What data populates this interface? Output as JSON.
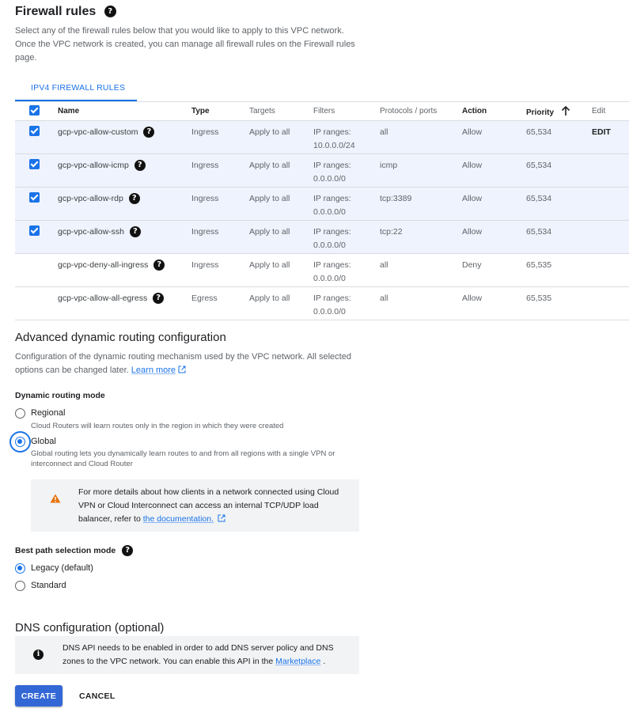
{
  "firewall": {
    "title": "Firewall rules",
    "description": "Select any of the firewall rules below that you would like to apply to this VPC network. Once the VPC network is created, you can manage all firewall rules on the Firewall rules page.",
    "tab_label": "IPV4 FIREWALL RULES",
    "columns": {
      "name": "Name",
      "type": "Type",
      "targets": "Targets",
      "filters": "Filters",
      "protocols": "Protocols / ports",
      "action": "Action",
      "priority": "Priority",
      "edit": "Edit"
    },
    "rows": [
      {
        "name": "gcp-vpc-allow-custom",
        "type": "Ingress",
        "targets": "Apply to all",
        "filter_label": "IP ranges:",
        "filter_value": "10.0.0.0/24",
        "protocols": "all",
        "action": "Allow",
        "priority": "65,534",
        "edit": "EDIT",
        "checked": true
      },
      {
        "name": "gcp-vpc-allow-icmp",
        "type": "Ingress",
        "targets": "Apply to all",
        "filter_label": "IP ranges:",
        "filter_value": "0.0.0.0/0",
        "protocols": "icmp",
        "action": "Allow",
        "priority": "65,534",
        "edit": "",
        "checked": true
      },
      {
        "name": "gcp-vpc-allow-rdp",
        "type": "Ingress",
        "targets": "Apply to all",
        "filter_label": "IP ranges:",
        "filter_value": "0.0.0.0/0",
        "protocols": "tcp:3389",
        "action": "Allow",
        "priority": "65,534",
        "edit": "",
        "checked": true
      },
      {
        "name": "gcp-vpc-allow-ssh",
        "type": "Ingress",
        "targets": "Apply to all",
        "filter_label": "IP ranges:",
        "filter_value": "0.0.0.0/0",
        "protocols": "tcp:22",
        "action": "Allow",
        "priority": "65,534",
        "edit": "",
        "checked": true
      },
      {
        "name": "gcp-vpc-deny-all-ingress",
        "type": "Ingress",
        "targets": "Apply to all",
        "filter_label": "IP ranges:",
        "filter_value": "0.0.0.0/0",
        "protocols": "all",
        "action": "Deny",
        "priority": "65,535",
        "edit": "",
        "checked": false
      },
      {
        "name": "gcp-vpc-allow-all-egress",
        "type": "Egress",
        "targets": "Apply to all",
        "filter_label": "IP ranges:",
        "filter_value": "0.0.0.0/0",
        "protocols": "all",
        "action": "Allow",
        "priority": "65,535",
        "edit": "",
        "checked": false
      }
    ]
  },
  "routing": {
    "title": "Advanced dynamic routing configuration",
    "description": "Configuration of the dynamic routing mechanism used by the VPC network. All selected options can be changed later.",
    "learn_more": "Learn more",
    "mode_label": "Dynamic routing mode",
    "regional_label": "Regional",
    "regional_desc": "Cloud Routers will learn routes only in the region in which they were created",
    "global_label": "Global",
    "global_desc": "Global routing lets you dynamically learn routes to and from all regions with a single VPN or interconnect and Cloud Router",
    "selected": "Global",
    "warning_text": "For more details about how clients in a network connected using Cloud VPN or Cloud Interconnect can access an internal TCP/UDP load balancer, refer to",
    "warning_link": "the documentation."
  },
  "best_path": {
    "title": "Best path selection mode",
    "legacy_label": "Legacy (default)",
    "standard_label": "Standard",
    "selected": "Legacy (default)"
  },
  "dns": {
    "title": "DNS configuration (optional)",
    "notice_text": "DNS API needs to be enabled in order to add DNS server policy and DNS zones to the VPC network. You can enable this API in the",
    "notice_link": "Marketplace",
    "notice_end": "."
  },
  "actions": {
    "create_label": "CREATE",
    "cancel_label": "CANCEL"
  },
  "colors": {
    "accent": "#1a73e8",
    "selected_row": "#eef3fd",
    "warning": "#e8710a",
    "create_button": "#3367d6"
  },
  "icons": [
    "help-icon",
    "external-link-icon",
    "sort-arrow-up-icon",
    "warning-icon",
    "info-icon",
    "checkbox-checked-icon"
  ]
}
